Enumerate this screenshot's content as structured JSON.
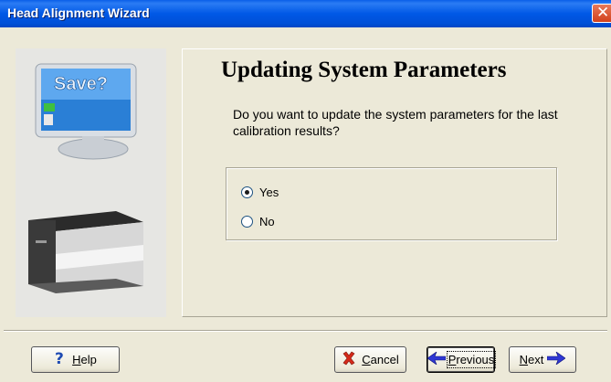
{
  "window": {
    "title": "Head Alignment Wizard"
  },
  "illustration": {
    "monitor_text": "Save?"
  },
  "content": {
    "heading": "Updating System Parameters",
    "question": "Do you want to update the system parameters for the last calibration results?",
    "options": [
      {
        "label": "Yes",
        "selected": true
      },
      {
        "label": "No",
        "selected": false
      }
    ]
  },
  "buttons": {
    "help": "Help",
    "cancel": "Cancel",
    "previous": "Previous",
    "next": "Next"
  },
  "colors": {
    "title_bar": "#0058e6",
    "window_bg": "#ece9d8",
    "close_button": "#d2411c"
  }
}
